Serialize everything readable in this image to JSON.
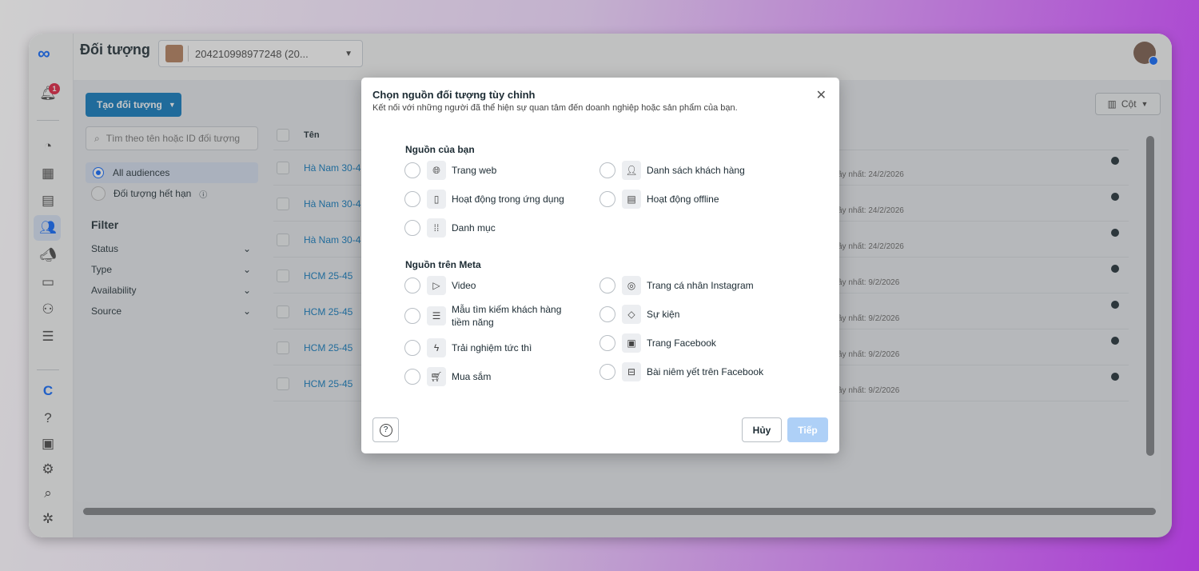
{
  "app": {
    "title": "Đối tượng",
    "account_id": "204210998977248 (20...",
    "notification_count": "1"
  },
  "toolbar": {
    "create_label": "Tạo đối tượng",
    "columns_label": "Cột"
  },
  "sidebar": {
    "search_placeholder": "Tìm theo tên hoặc ID đối tượng",
    "all_audiences": "All audiences",
    "expired": "Đối tượng hết hạn",
    "filter_heading": "Filter",
    "filters": [
      "Status",
      "Type",
      "Availability",
      "Source"
    ]
  },
  "table": {
    "header_name": "Tên",
    "rows": [
      {
        "name": "Hà Nam 30-4",
        "date": "ây nhất: 24/2/2026"
      },
      {
        "name": "Hà Nam 30-4",
        "date": "ây nhất: 24/2/2026"
      },
      {
        "name": "Hà Nam 30-4",
        "date": "ây nhất: 24/2/2026"
      },
      {
        "name": "HCM 25-45",
        "date": "ây nhất: 9/2/2026"
      },
      {
        "name": "HCM 25-45",
        "date": "ây nhất: 9/2/2026"
      },
      {
        "name": "HCM 25-45",
        "date": "ây nhất: 9/2/2026"
      },
      {
        "name": "HCM 25-45",
        "date": "ây nhất: 9/2/2026"
      }
    ]
  },
  "modal": {
    "title": "Chọn nguồn đối tượng tùy chỉnh",
    "subtitle": "Kết nối với những người đã thể hiện sự quan tâm đến doanh nghiệp hoặc sản phẩm của bạn.",
    "section_yours": "Nguồn của bạn",
    "yours": [
      {
        "label": "Trang web",
        "icon": "globe-icon"
      },
      {
        "label": "Danh sách khách hàng",
        "icon": "customer-list-icon"
      },
      {
        "label": "Hoạt động trong ứng dụng",
        "icon": "mobile-app-icon"
      },
      {
        "label": "Hoạt động offline",
        "icon": "store-icon"
      },
      {
        "label": "Danh mục",
        "icon": "catalog-icon"
      }
    ],
    "section_meta": "Nguồn trên Meta",
    "meta": [
      {
        "label": "Video",
        "icon": "play-icon"
      },
      {
        "label": "Trang cá nhân Instagram",
        "icon": "instagram-icon"
      },
      {
        "label": "Mẫu tìm kiếm khách hàng tiềm năng",
        "icon": "lead-form-icon"
      },
      {
        "label": "Sự kiện",
        "icon": "event-tag-icon"
      },
      {
        "label": "Trải nghiệm tức thì",
        "icon": "lightning-icon"
      },
      {
        "label": "Trang Facebook",
        "icon": "facebook-page-icon"
      },
      {
        "label": "Mua sắm",
        "icon": "cart-icon"
      },
      {
        "label": "Bài niêm yết trên Facebook",
        "icon": "marketplace-icon"
      }
    ],
    "help": "?",
    "cancel": "Hủy",
    "next": "Tiếp"
  }
}
